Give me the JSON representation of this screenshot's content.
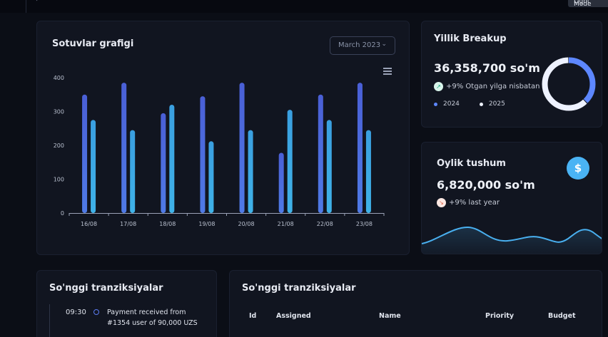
{
  "topbar": {
    "theme_button": "Light Mode"
  },
  "sales_card": {
    "title": "Sotuvlar grafigi",
    "month_select": "March 2023"
  },
  "chart_data": {
    "type": "bar",
    "title": "Sotuvlar grafigi",
    "categories": [
      "16/08",
      "17/08",
      "18/08",
      "19/08",
      "20/08",
      "21/08",
      "22/08",
      "23/08"
    ],
    "series": [
      {
        "values": [
          350,
          385,
          295,
          345,
          385,
          178,
          350,
          385
        ]
      },
      {
        "values": [
          275,
          245,
          320,
          212,
          245,
          305,
          275,
          245
        ]
      }
    ],
    "ylim": [
      0,
      400
    ],
    "yticks": [
      0,
      100,
      200,
      300,
      400
    ],
    "colors": [
      "#4f66d8",
      "#3aa2e0"
    ]
  },
  "breakup_card": {
    "title": "Yillik Breakup",
    "amount": "36,358,700 so'm",
    "trend": "+9% Otgan yilga nisbatan",
    "legend": [
      "2024",
      "2025"
    ],
    "donut": [
      {
        "label": "2024",
        "value": 38,
        "color": "#5d87ff"
      },
      {
        "label": "2025",
        "value": 62,
        "color": "#eef2ff"
      }
    ]
  },
  "monthly_card": {
    "title": "Oylik tushum",
    "amount": "6,820,000 so'm",
    "trend": "+9% last year",
    "icon": "$"
  },
  "transactions_card": {
    "title": "So'nggi tranziksiyalar",
    "time": "09:30",
    "text": "Payment received from #1354 user of 90,000 UZS"
  },
  "table_card": {
    "title": "So'nggi tranziksiyalar",
    "columns": [
      "Id",
      "Assigned",
      "Name",
      "Priority",
      "Budget"
    ]
  }
}
